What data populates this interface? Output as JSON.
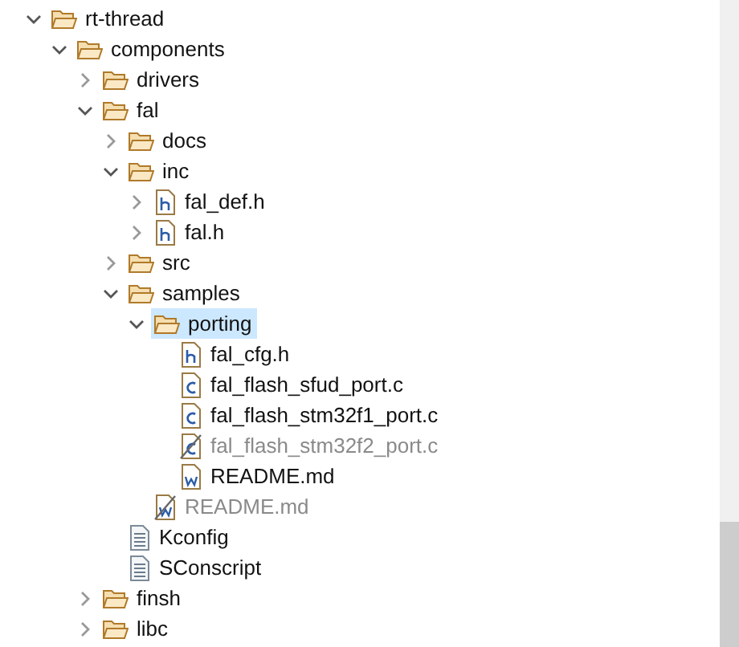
{
  "tree": [
    {
      "label": "rt-thread",
      "kind": "folder",
      "expanded": true,
      "selected": false,
      "disabled": false,
      "children": [
        {
          "label": "components",
          "kind": "folder",
          "expanded": true,
          "selected": false,
          "disabled": false,
          "children": [
            {
              "label": "drivers",
              "kind": "folder",
              "expanded": false,
              "selected": false,
              "disabled": false
            },
            {
              "label": "fal",
              "kind": "folder",
              "expanded": true,
              "selected": false,
              "disabled": false,
              "children": [
                {
                  "label": "docs",
                  "kind": "folder",
                  "expanded": false,
                  "selected": false,
                  "disabled": false
                },
                {
                  "label": "inc",
                  "kind": "folder",
                  "expanded": true,
                  "selected": false,
                  "disabled": false,
                  "children": [
                    {
                      "label": "fal_def.h",
                      "kind": "header",
                      "expanded": false,
                      "selected": false,
                      "disabled": false
                    },
                    {
                      "label": "fal.h",
                      "kind": "header",
                      "expanded": false,
                      "selected": false,
                      "disabled": false
                    }
                  ]
                },
                {
                  "label": "src",
                  "kind": "folder",
                  "expanded": false,
                  "selected": false,
                  "disabled": false
                },
                {
                  "label": "samples",
                  "kind": "folder",
                  "expanded": true,
                  "selected": false,
                  "disabled": false,
                  "children": [
                    {
                      "label": "porting",
                      "kind": "folder",
                      "expanded": true,
                      "selected": true,
                      "disabled": false,
                      "children": [
                        {
                          "label": "fal_cfg.h",
                          "kind": "header",
                          "selected": false,
                          "disabled": false
                        },
                        {
                          "label": "fal_flash_sfud_port.c",
                          "kind": "source",
                          "selected": false,
                          "disabled": false
                        },
                        {
                          "label": "fal_flash_stm32f1_port.c",
                          "kind": "source",
                          "selected": false,
                          "disabled": false
                        },
                        {
                          "label": "fal_flash_stm32f2_port.c",
                          "kind": "source",
                          "selected": false,
                          "disabled": true
                        },
                        {
                          "label": "README.md",
                          "kind": "markdown",
                          "selected": false,
                          "disabled": false
                        }
                      ]
                    },
                    {
                      "label": "README.md",
                      "kind": "markdown",
                      "selected": false,
                      "disabled": true
                    }
                  ]
                },
                {
                  "label": "Kconfig",
                  "kind": "text",
                  "selected": false,
                  "disabled": false
                },
                {
                  "label": "SConscript",
                  "kind": "text",
                  "selected": false,
                  "disabled": false
                }
              ]
            },
            {
              "label": "finsh",
              "kind": "folder",
              "expanded": false,
              "selected": false,
              "disabled": false
            },
            {
              "label": "libc",
              "kind": "folder",
              "expanded": false,
              "selected": false,
              "disabled": false
            }
          ]
        }
      ]
    }
  ]
}
